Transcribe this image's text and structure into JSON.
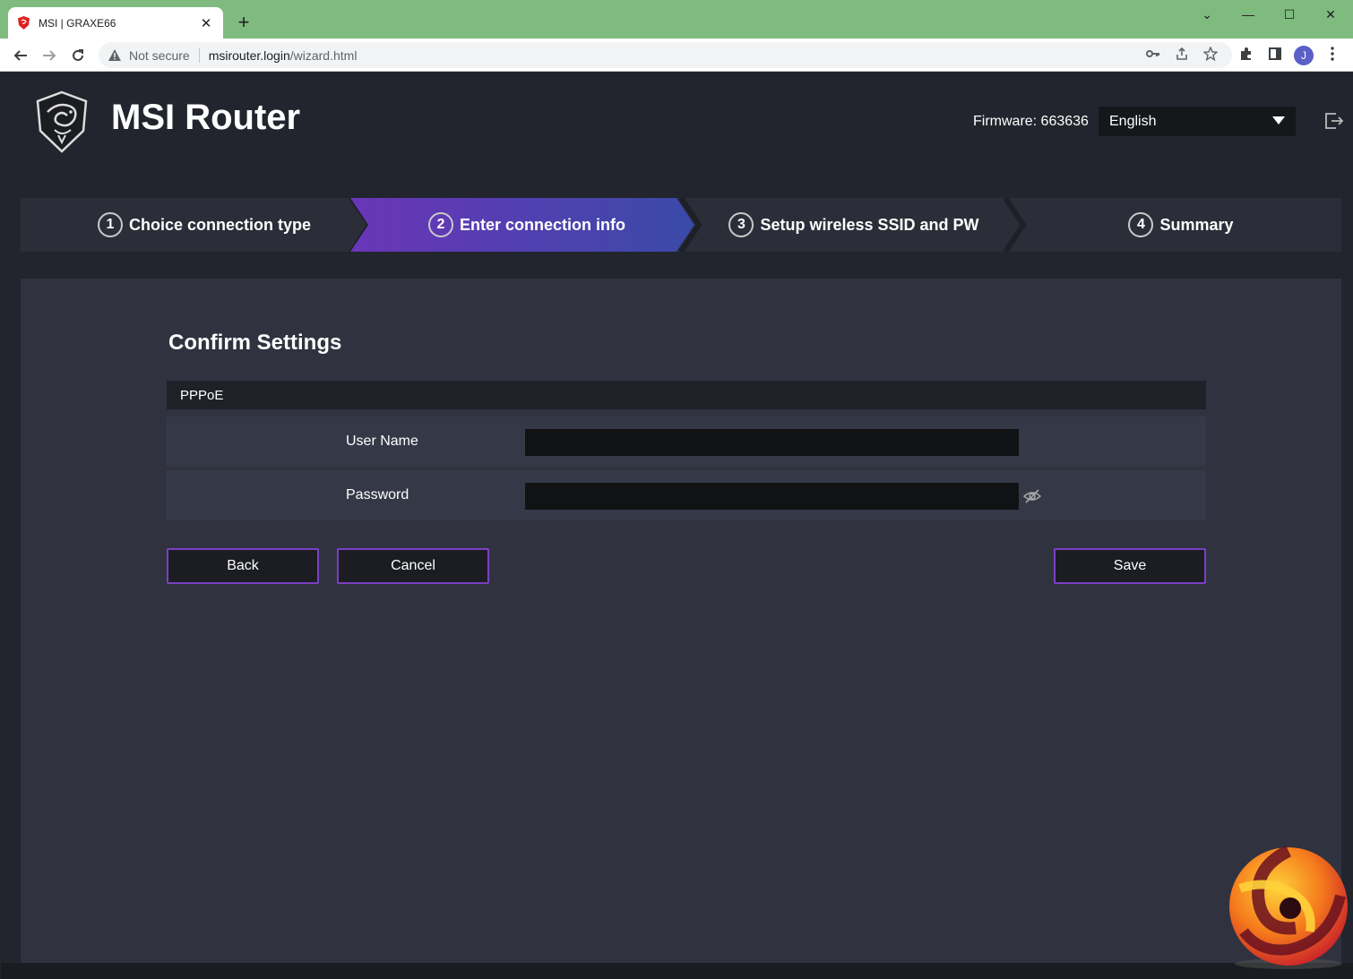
{
  "browser": {
    "tab_title": "MSI | GRAXE66",
    "not_secure": "Not secure",
    "url_host": "msirouter.login",
    "url_path": "/wizard.html",
    "avatar_letter": "J",
    "theme_color": "#7fba7f"
  },
  "header": {
    "brand": "MSI Router",
    "firmware": "Firmware: 663636",
    "language": "English"
  },
  "steps": [
    {
      "num": "1",
      "label": "Choice connection type",
      "active": false
    },
    {
      "num": "2",
      "label": "Enter connection info",
      "active": true
    },
    {
      "num": "3",
      "label": "Setup wireless SSID and PW",
      "active": false
    },
    {
      "num": "4",
      "label": "Summary",
      "active": false
    }
  ],
  "form": {
    "heading": "Confirm Settings",
    "section": "PPPoE",
    "username_label": "User Name",
    "username_value": "",
    "password_label": "Password",
    "password_value": ""
  },
  "buttons": {
    "back": "Back",
    "cancel": "Cancel",
    "save": "Save"
  },
  "colors": {
    "accent": "#7b3fc4",
    "active_step_start": "#6a35b8",
    "active_step_end": "#3a4aa8"
  }
}
